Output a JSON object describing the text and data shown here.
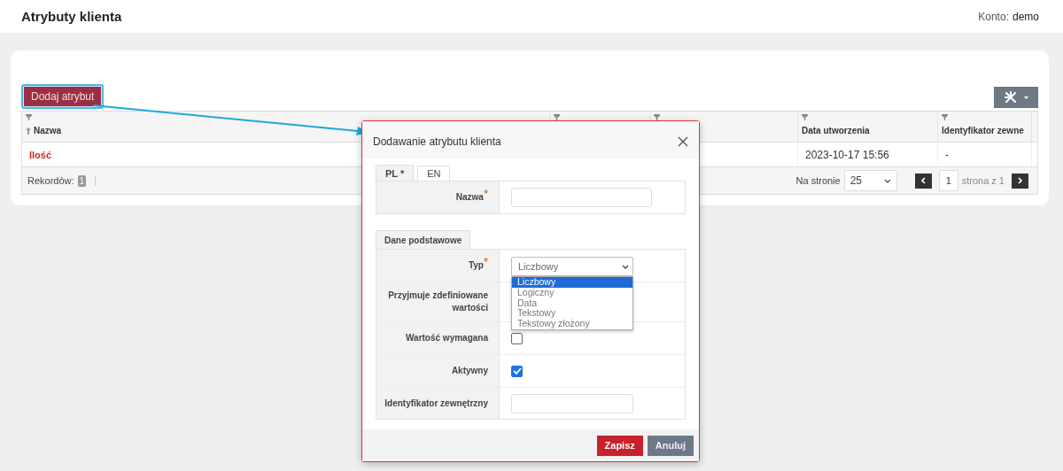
{
  "header": {
    "title": "Atrybuty klienta",
    "account_label": "Konto:",
    "account": "demo"
  },
  "toolbar": {
    "add_button": "Dodaj atrybut"
  },
  "table": {
    "columns": [
      {
        "label": "Nazwa",
        "sorted_ascending": true,
        "filter": true
      },
      {
        "filter": true
      },
      {
        "filter": true
      },
      {
        "label": "Data utworzenia",
        "filter": true
      },
      {
        "label": "Identyfikator zewne",
        "filter": true
      }
    ],
    "rows": [
      {
        "cells": [
          "Ilość",
          null,
          null,
          "2023-10-17 15:56",
          "-"
        ]
      }
    ]
  },
  "pager": {
    "records_label": "Rekordów:",
    "records_count": "1",
    "per_page_label": "Na stronie",
    "per_page": "25",
    "page": "1",
    "page_of": "strona z 1"
  },
  "dialog": {
    "title": "Dodawanie atrybutu klienta",
    "language_tabs": [
      {
        "label": "PL *",
        "selected": true
      },
      {
        "label": "EN",
        "selected": false
      }
    ],
    "name_field": {
      "label": "Nazwa",
      "required_mark": "*"
    },
    "section_tab": "Dane podstawowe",
    "fields": [
      {
        "kind": "select",
        "label": "Typ",
        "required_mark": "*",
        "value": "Liczbowy",
        "options": [
          {
            "label": "Liczbowy",
            "selected": true
          },
          {
            "label": "Logiczny",
            "selected": false
          },
          {
            "label": "Data",
            "selected": false
          },
          {
            "label": "Tekstowy",
            "selected": false
          },
          {
            "label": "Tekstowy złożony",
            "selected": false
          }
        ]
      },
      {
        "kind": "covered",
        "label": "Przyjmuje zdefiniowane wartości"
      },
      {
        "kind": "checkbox",
        "label": "Wartość wymagana",
        "checked": false
      },
      {
        "kind": "checkbox",
        "label": "Aktywny",
        "checked": true
      },
      {
        "kind": "text",
        "label": "Identyfikator zewnętrzny"
      }
    ],
    "buttons": [
      {
        "label": "Zapisz",
        "kind": "primary"
      },
      {
        "label": "Anuluj",
        "kind": "secondary"
      }
    ]
  }
}
